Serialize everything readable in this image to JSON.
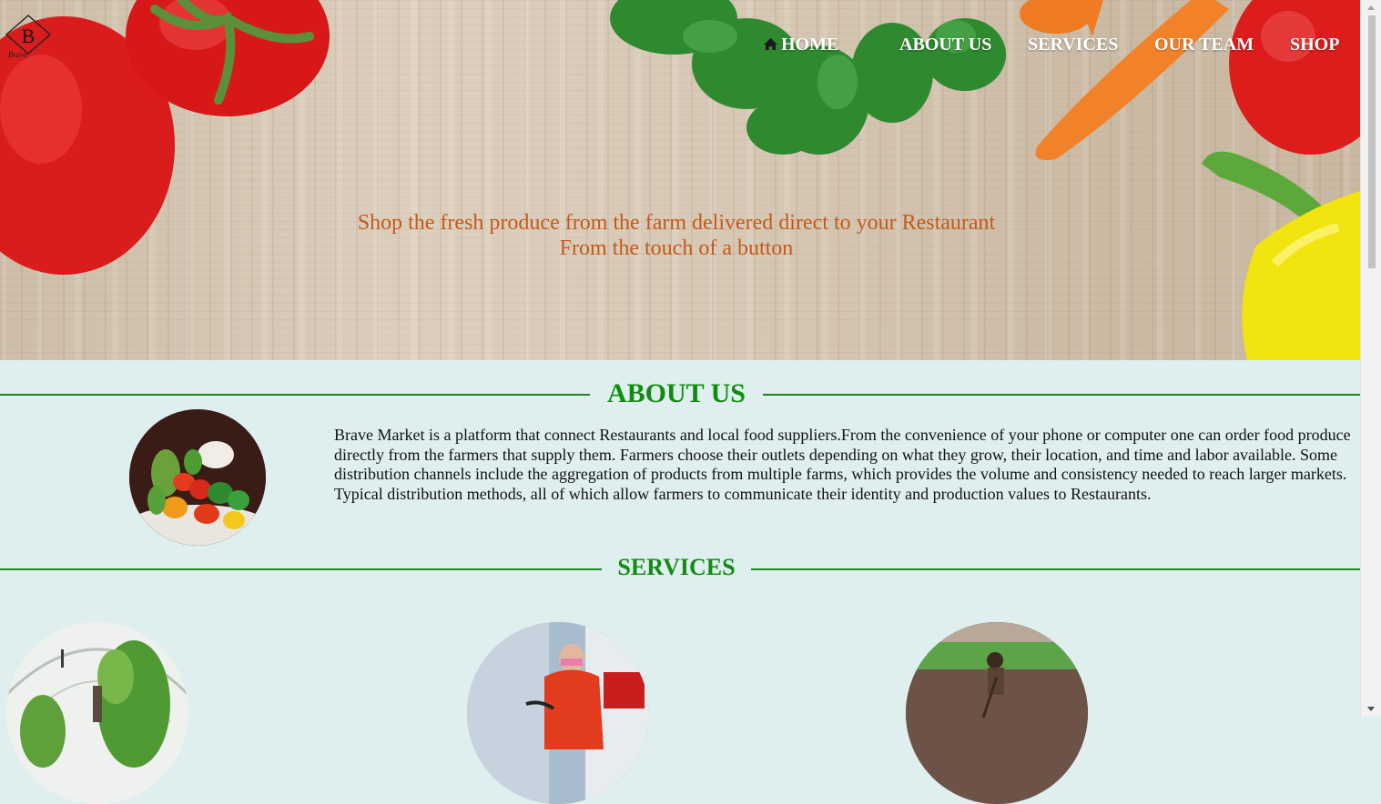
{
  "brand": {
    "logo_text": "Brave",
    "logo_letter": "B"
  },
  "nav": {
    "home": "HOME",
    "about": "ABOUT US",
    "services": "SERVICES",
    "team": "OUR TEAM",
    "shop": "SHOP",
    "home_icon": "home-icon"
  },
  "hero": {
    "line1": "Shop the fresh produce from the farm delivered direct to your Restaurant",
    "line2": "From the touch of a button"
  },
  "about": {
    "title": "ABOUT US",
    "text": "Brave Market is a platform that connect Restaurants and local food suppliers.From the convenience of your phone or computer one can order food produce directly from the farmers that supply them. Farmers choose their outlets depending on what they grow, their location, and time and labor available. Some distribution channels include the aggregation of products from multiple farms, which provides the volume and consistency needed to reach larger markets. Typical distribution methods, all of which allow farmers to communicate their identity and production values to Restaurants."
  },
  "services": {
    "title": "SERVICES"
  },
  "colors": {
    "accent_green": "#118c11",
    "tagline_orange": "#c45a18",
    "section_bg": "#dfefef"
  }
}
